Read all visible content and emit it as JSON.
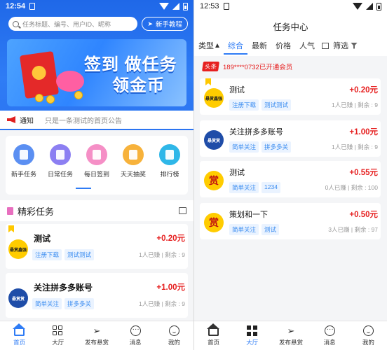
{
  "left": {
    "status": {
      "time": "12:54"
    },
    "search": {
      "placeholder": "任务标题、编号、用户ID、昵称",
      "tutorial_label": "新手教程"
    },
    "banner": {
      "line1": "签到 做任务",
      "line2": "领金币"
    },
    "notice": {
      "label": "通知",
      "text": "只是一条测试的首页公告"
    },
    "quick_icons": [
      {
        "label": "新手任务",
        "color": "#5b8ff2"
      },
      {
        "label": "日常任务",
        "color": "#8c7ff2"
      },
      {
        "label": "每日签到",
        "color": "#f58fc6"
      },
      {
        "label": "天天抽奖",
        "color": "#f7b23b"
      },
      {
        "label": "排行榜",
        "color": "#2fb7e8"
      }
    ],
    "section_title": "精彩任务",
    "tasks": [
      {
        "title": "测试",
        "price": "+0.20元",
        "tags": [
          "注册下载",
          "测试测试"
        ],
        "meta": "1人已赚 | 剩余 : 9",
        "logo_text": "悬赏鑫强"
      },
      {
        "title": "关注拼多多账号",
        "price": "+1.00元",
        "tags": [
          "简单关注",
          "拼多多关"
        ],
        "meta": "1人已赚 | 剩余 : 9",
        "logo_text": "悬赏赏"
      }
    ],
    "tabs": [
      {
        "label": "首页",
        "icon": "home-icon"
      },
      {
        "label": "大厅",
        "icon": "grid-icon"
      },
      {
        "label": "发布悬赏",
        "icon": "send-icon"
      },
      {
        "label": "消息",
        "icon": "message-icon"
      },
      {
        "label": "我的",
        "icon": "user-icon"
      }
    ]
  },
  "right": {
    "status": {
      "time": "12:53"
    },
    "title": "任务中心",
    "filters": {
      "type": "类型",
      "comprehensive": "综合",
      "latest": "最新",
      "price": "价格",
      "popular": "人气",
      "filter": "筛选"
    },
    "news": {
      "badge": "头条",
      "text": "189****0732已开通会员"
    },
    "tasks": [
      {
        "title": "测试",
        "price": "+0.20元",
        "tags": [
          "注册下载",
          "测试测试"
        ],
        "meta": "1人已赚 | 剩余 : 9",
        "logo_text": "悬赏鑫强"
      },
      {
        "title": "关注拼多多账号",
        "price": "+1.00元",
        "tags": [
          "简单关注",
          "拼多多关"
        ],
        "meta": "1人已赚 | 剩余 : 9",
        "logo_text": "悬赏赏"
      },
      {
        "title": "测试",
        "price": "+0.55元",
        "tags": [
          "简单关注",
          "1234"
        ],
        "meta": "0人已赚 | 剩余 : 100",
        "logo_text": "赏"
      },
      {
        "title": "策划和一下",
        "price": "+0.50元",
        "tags": [
          "简单关注",
          "测试"
        ],
        "meta": "3人已赚 | 剩余 : 97",
        "logo_text": "赏"
      }
    ],
    "tabs": [
      {
        "label": "首页",
        "icon": "home-icon"
      },
      {
        "label": "大厅",
        "icon": "grid-icon"
      },
      {
        "label": "发布悬赏",
        "icon": "send-icon"
      },
      {
        "label": "消息",
        "icon": "message-icon"
      },
      {
        "label": "我的",
        "icon": "user-icon"
      }
    ]
  },
  "colors": {
    "primary": "#2f7cf5",
    "price": "#e62020",
    "tag_bg": "#eaf3ff"
  }
}
